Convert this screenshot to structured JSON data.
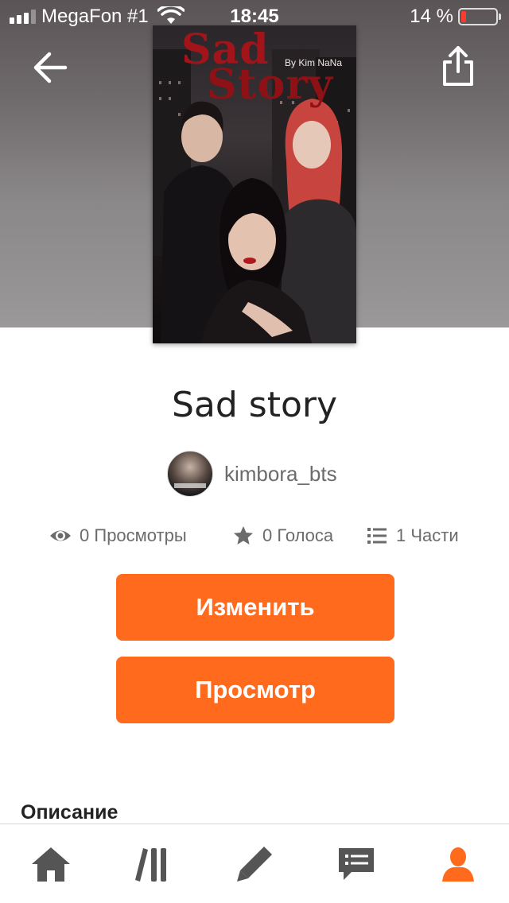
{
  "status_bar": {
    "carrier": "MegaFon #1",
    "time": "18:45",
    "battery_percent": "14 %",
    "battery_level": 0.14,
    "signal_bars": 3
  },
  "header": {
    "back_icon": "arrow-left-icon",
    "share_icon": "share-icon"
  },
  "cover": {
    "title_line1": "Sad",
    "title_line2": "Story",
    "byline": "By Kim NaNa"
  },
  "story": {
    "title": "Sad story",
    "author": "kimbora_bts"
  },
  "stats": {
    "views": {
      "count": "0",
      "label": "Просмотры",
      "icon": "eye-icon"
    },
    "votes": {
      "count": "0",
      "label": "Голоса",
      "icon": "star-icon"
    },
    "parts": {
      "count": "1",
      "label": "Части",
      "icon": "list-icon"
    }
  },
  "actions": {
    "edit_label": "Изменить",
    "preview_label": "Просмотр"
  },
  "description": {
    "heading": "Описание"
  },
  "bottom_nav": {
    "items": [
      {
        "icon": "home-icon",
        "active": false
      },
      {
        "icon": "library-icon",
        "active": false
      },
      {
        "icon": "pencil-icon",
        "active": false
      },
      {
        "icon": "messages-icon",
        "active": false
      },
      {
        "icon": "profile-icon",
        "active": true
      }
    ]
  },
  "colors": {
    "accent": "#ff6a1d",
    "nav_inactive": "#555555",
    "text_secondary": "#6b6b6b"
  }
}
